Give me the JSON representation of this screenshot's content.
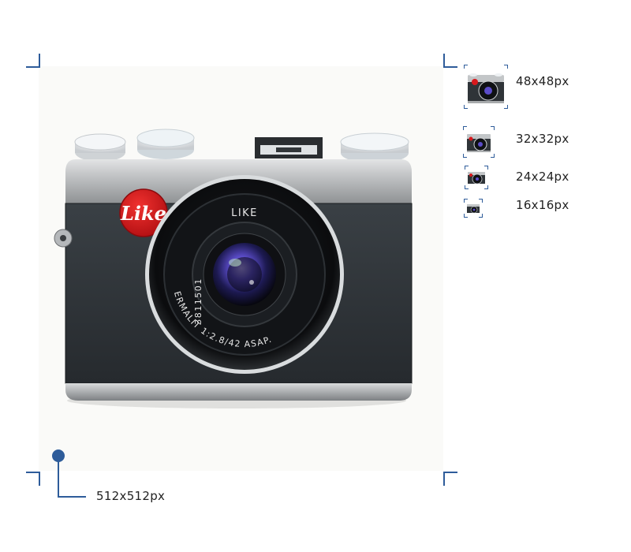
{
  "main_icon": {
    "size_label": "512x512px",
    "brand_logo_text": "Like",
    "lens_brand_text": "LIKE",
    "lens_serial_text": "3811501",
    "lens_spec_text": "ERMALIT 1:2.8/42 ASAP."
  },
  "size_variants": [
    {
      "label": "48x48px"
    },
    {
      "label": "32x32px"
    },
    {
      "label": "24x24px"
    },
    {
      "label": "16x16px"
    }
  ],
  "colors": {
    "guide_blue": "#2e5c9a",
    "logo_red": "#d8181c",
    "body_dark": "#2f3438",
    "top_plate_silver": "#b9bcbe"
  },
  "icon_names": [
    "camera-icon",
    "crop-mark-icon",
    "dimension-marker-icon"
  ]
}
